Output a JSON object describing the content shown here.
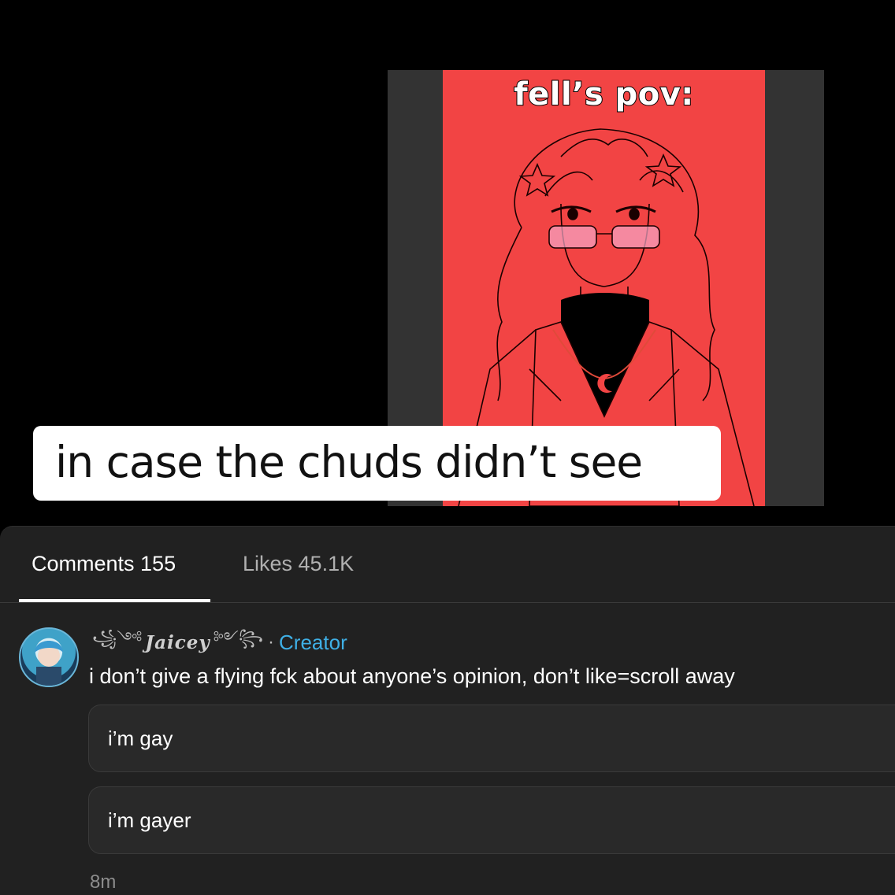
{
  "video": {
    "overlay_text": "fell’s pov:",
    "caption": "in case the chuds didn’t see"
  },
  "tabs": {
    "comments_label": "Comments 155",
    "likes_label": "Likes 45.1K"
  },
  "comment": {
    "author_prefix": "꧁༺",
    "author": "Jaicey",
    "author_suffix": "༻꧂",
    "separator": "·",
    "badge": "Creator",
    "text": "i don’t give a flying fck about anyone’s opinion, don’t like=scroll away",
    "replies": [
      {
        "text": "i’m gay"
      },
      {
        "text": "i’m gayer"
      }
    ],
    "time": "8m"
  },
  "colors": {
    "art_background": "#f24444",
    "creator_badge": "#3fb0e6",
    "sheet_background": "#212121"
  }
}
